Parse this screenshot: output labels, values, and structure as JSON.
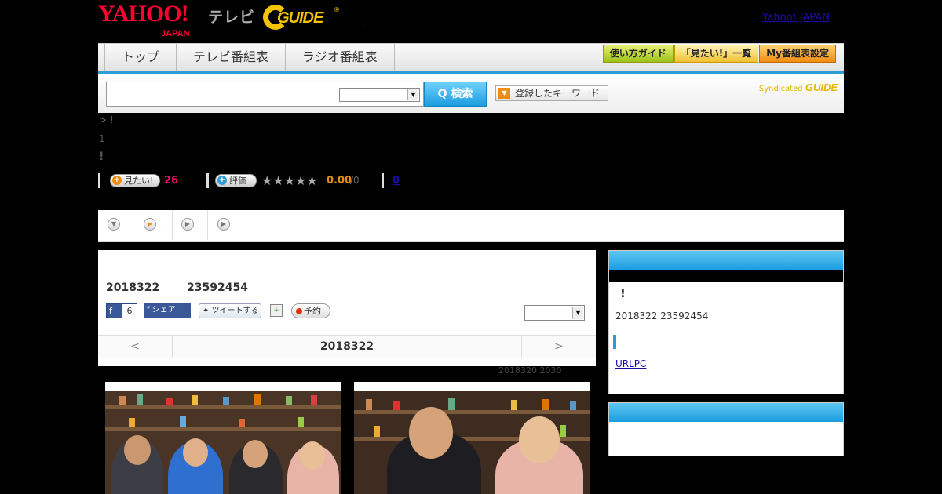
{
  "header": {
    "logo_yahoo": "YAHOO!",
    "logo_japan": "JAPAN",
    "logo_tv": "テレビ",
    "logo_gguide": "GUIDE",
    "logo_reg": "®",
    "dot": ",",
    "yahoo_link": "Yahoo! JAPAN",
    "comma": ","
  },
  "nav": {
    "tabs": [
      "トップ",
      "テレビ番組表",
      "ラジオ番組表"
    ],
    "buttons": [
      "使い方ガイド",
      "「見たい!」一覧",
      "My番組表設定"
    ]
  },
  "search": {
    "button": "Q 検索",
    "keyword_button": "登録したキーワード",
    "arrow": "▼",
    "syndicated": "Syndicated",
    "syndicated_brand": "GUIDE"
  },
  "crumb": "> !",
  "info1": "1",
  "info2": "!",
  "stats": {
    "want_label": "見たい!",
    "want_count": "26",
    "rate_label": "評価",
    "stars": "★★★★★",
    "rating": "0.00",
    "rating_of": "/0",
    "link": "0"
  },
  "tabs2": {
    "icons": [
      "▼",
      "▶",
      "▶",
      "▶"
    ],
    "tab1_label": "."
  },
  "program": {
    "date": "2018322",
    "time": "23592454",
    "fb_like": "6",
    "fb_share": "シェア",
    "tweet": "ツイートする",
    "reserve": "予約",
    "day_prev": "<",
    "day_current": "2018322",
    "day_next": ">",
    "updated": "2018320  2030"
  },
  "sidebar": {
    "title": "!",
    "date": "2018322  23592454",
    "url": "URLPC   "
  },
  "colors": {
    "accent": "#2c9bd6",
    "count": "#e0106a",
    "rating": "#e08a10"
  }
}
